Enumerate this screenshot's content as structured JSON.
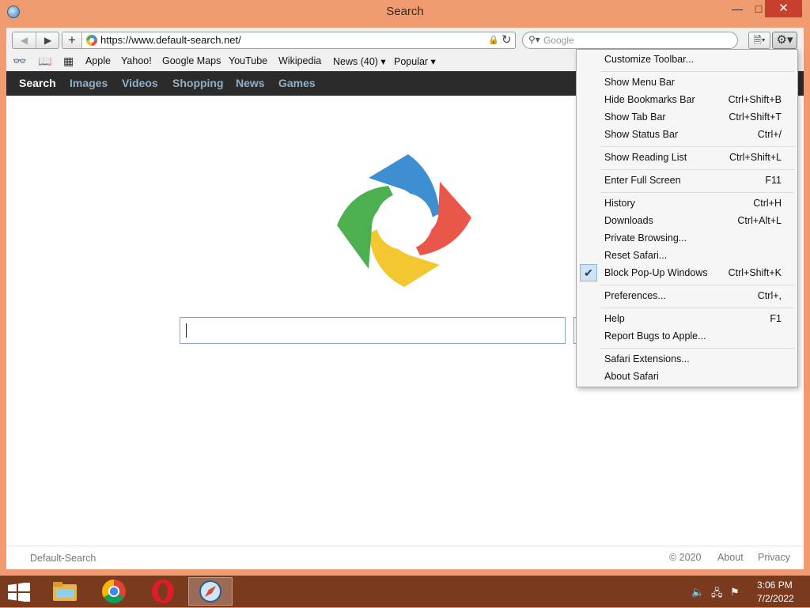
{
  "window": {
    "title": "Search"
  },
  "toolbar": {
    "url": "https://www.default-search.net/",
    "search_placeholder": "Google"
  },
  "bookmarks": [
    "Apple",
    "Yahoo!",
    "Google Maps",
    "YouTube",
    "Wikipedia",
    "News (40) ▾",
    "Popular ▾"
  ],
  "page": {
    "nav": [
      "Search",
      "Images",
      "Videos",
      "Shopping",
      "News",
      "Games"
    ],
    "footer": {
      "brand": "Default-Search",
      "copyright": "© 2020",
      "about": "About",
      "privacy": "Privacy"
    }
  },
  "menu": {
    "items": [
      {
        "label": "Customize Toolbar...",
        "shortcut": ""
      },
      {
        "label": "Show Menu Bar",
        "shortcut": ""
      },
      {
        "label": "Hide Bookmarks Bar",
        "shortcut": "Ctrl+Shift+B"
      },
      {
        "label": "Show Tab Bar",
        "shortcut": "Ctrl+Shift+T"
      },
      {
        "label": "Show Status Bar",
        "shortcut": "Ctrl+/"
      },
      {
        "label": "Show Reading List",
        "shortcut": "Ctrl+Shift+L"
      },
      {
        "label": "Enter Full Screen",
        "shortcut": "F11"
      },
      {
        "label": "History",
        "shortcut": "Ctrl+H"
      },
      {
        "label": "Downloads",
        "shortcut": "Ctrl+Alt+L"
      },
      {
        "label": "Private Browsing...",
        "shortcut": ""
      },
      {
        "label": "Reset Safari...",
        "shortcut": ""
      },
      {
        "label": "Block Pop-Up Windows",
        "shortcut": "Ctrl+Shift+K",
        "checked": true
      },
      {
        "label": "Preferences...",
        "shortcut": "Ctrl+,"
      },
      {
        "label": "Help",
        "shortcut": "F1"
      },
      {
        "label": "Report Bugs to Apple...",
        "shortcut": ""
      },
      {
        "label": "Safari Extensions...",
        "shortcut": ""
      },
      {
        "label": "About Safari",
        "shortcut": ""
      }
    ]
  },
  "taskbar": {
    "time": "3:06 PM",
    "date": "7/2/2022"
  },
  "colors": {
    "frame": "#ef9a6f",
    "taskbar": "#7a3a1e",
    "close_button": "#c7402f",
    "nav_strip": "#2b2b2b",
    "nav_link": "#8fb0c8"
  }
}
